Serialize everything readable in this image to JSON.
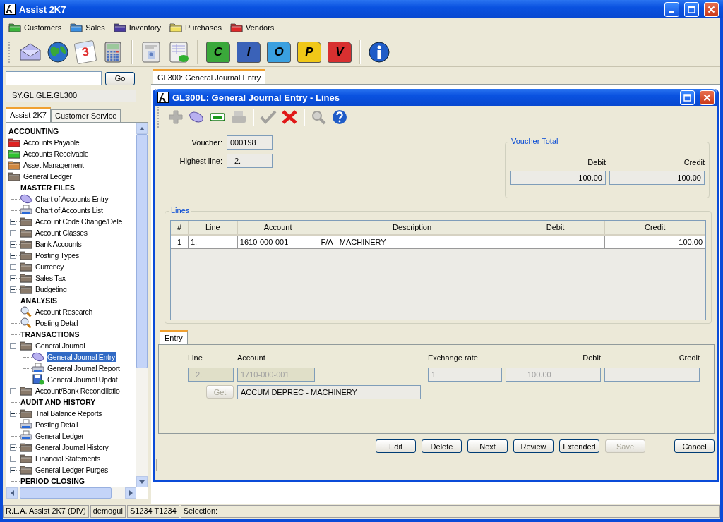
{
  "window": {
    "title": "Assist 2K7"
  },
  "menu": [
    {
      "label": "Customers",
      "color": "#3cb43c"
    },
    {
      "label": "Sales",
      "color": "#3a8ee0"
    },
    {
      "label": "Inventory",
      "color": "#4a3aa0"
    },
    {
      "label": "Purchases",
      "color": "#f0e060"
    },
    {
      "label": "Vendors",
      "color": "#e02828"
    }
  ],
  "toolbar": [
    [
      {
        "kind": "mail"
      },
      {
        "kind": "globe"
      },
      {
        "kind": "calendar",
        "text": "3"
      },
      {
        "kind": "calculator"
      }
    ],
    [
      {
        "kind": "contacts"
      },
      {
        "kind": "report"
      }
    ],
    [
      {
        "kind": "folder",
        "text": "C",
        "color": "#3aa83a"
      },
      {
        "kind": "folder",
        "text": "I",
        "color": "#3a62b8"
      },
      {
        "kind": "folder",
        "text": "O",
        "color": "#3aa0e0"
      },
      {
        "kind": "folder",
        "text": "P",
        "color": "#f0c818"
      },
      {
        "kind": "folder",
        "text": "V",
        "color": "#d83030"
      }
    ],
    [
      {
        "kind": "info"
      }
    ]
  ],
  "navigator": {
    "go_button": "Go",
    "path": "SY.GL.GLE.GL300",
    "tabs": [
      {
        "label": "Assist 2K7",
        "selected": true
      },
      {
        "label": "Customer Service",
        "selected": false
      }
    ],
    "tree": [
      {
        "label": "ACCOUNTING",
        "kind": "heading",
        "selected": false
      },
      {
        "label": "Accounts Payable",
        "kind": "folder",
        "color": "#e02020",
        "selected": false
      },
      {
        "label": "Accounts Receivable",
        "kind": "folder",
        "color": "#30c030",
        "selected": false
      },
      {
        "label": "Asset Management",
        "kind": "folder",
        "color": "#d08840",
        "selected": false
      },
      {
        "label": "General Ledger",
        "kind": "folder",
        "color": "#8a7a6a",
        "selected": false,
        "children": [
          {
            "label": "MASTER FILES",
            "kind": "heading",
            "selected": false
          },
          {
            "label": "Chart of Accounts Entry",
            "kind": "entry",
            "selected": false
          },
          {
            "label": "Chart of Accounts List",
            "kind": "report",
            "selected": false
          },
          {
            "label": "Account Code Change/Dele",
            "kind": "folder",
            "color": "#8a7a6a",
            "expanded": false,
            "selected": false
          },
          {
            "label": "Account Classes",
            "kind": "folder",
            "color": "#8a7a6a",
            "expanded": false,
            "selected": false
          },
          {
            "label": "Bank Accounts",
            "kind": "folder",
            "color": "#8a7a6a",
            "expanded": false,
            "selected": false
          },
          {
            "label": "Posting Types",
            "kind": "folder",
            "color": "#8a7a6a",
            "expanded": false,
            "selected": false
          },
          {
            "label": "Currency",
            "kind": "folder",
            "color": "#8a7a6a",
            "expanded": false,
            "selected": false
          },
          {
            "label": "Sales Tax",
            "kind": "folder",
            "color": "#8a7a6a",
            "expanded": false,
            "selected": false
          },
          {
            "label": "Budgeting",
            "kind": "folder",
            "color": "#8a7a6a",
            "expanded": false,
            "selected": false
          },
          {
            "label": "ANALYSIS",
            "kind": "heading",
            "selected": false
          },
          {
            "label": "Account Research",
            "kind": "search",
            "selected": false
          },
          {
            "label": "Posting Detail",
            "kind": "search",
            "selected": false
          },
          {
            "label": "TRANSACTIONS",
            "kind": "heading",
            "selected": false
          },
          {
            "label": "General Journal",
            "kind": "folder",
            "color": "#8a7a6a",
            "expanded": true,
            "selected": false,
            "children": [
              {
                "label": "General Journal Entry",
                "kind": "entry",
                "selected": true
              },
              {
                "label": "General Journal Report",
                "kind": "report",
                "selected": false
              },
              {
                "label": "General Journal Updat",
                "kind": "update",
                "selected": false
              }
            ]
          },
          {
            "label": "Account/Bank Reconciliatio",
            "kind": "folder",
            "color": "#8a7a6a",
            "expanded": false,
            "selected": false
          },
          {
            "label": "AUDIT AND HISTORY",
            "kind": "heading",
            "selected": false
          },
          {
            "label": "Trial Balance Reports",
            "kind": "folder",
            "color": "#8a7a6a",
            "expanded": false,
            "selected": false
          },
          {
            "label": "Posting Detail",
            "kind": "report",
            "selected": false
          },
          {
            "label": "General Ledger",
            "kind": "report",
            "selected": false
          },
          {
            "label": "General Journal History",
            "kind": "folder",
            "color": "#8a7a6a",
            "expanded": false,
            "selected": false
          },
          {
            "label": "Financial Statements",
            "kind": "folder",
            "color": "#8a7a6a",
            "expanded": false,
            "selected": false
          },
          {
            "label": "General Ledger Purges",
            "kind": "folder",
            "color": "#8a7a6a",
            "expanded": false,
            "selected": false
          },
          {
            "label": "PERIOD CLOSING",
            "kind": "heading",
            "selected": false
          }
        ]
      }
    ]
  },
  "document_tabs": [
    {
      "label": "GL300: General Journal Entry",
      "selected": true
    }
  ],
  "form": {
    "title": "GL300L: General Journal Entry - Lines",
    "tools": [
      {
        "kind": "add",
        "disabled": true
      },
      {
        "kind": "edit",
        "disabled": false
      },
      {
        "kind": "minus",
        "disabled": false
      },
      {
        "kind": "print",
        "disabled": true
      },
      {
        "kind": "accept",
        "disabled": true
      },
      {
        "kind": "cancel",
        "disabled": false
      },
      {
        "kind": "find",
        "disabled": true
      },
      {
        "kind": "help",
        "disabled": false
      }
    ],
    "voucher_label": "Voucher:",
    "voucher": "000198",
    "highest_line_label": "Highest line:",
    "highest_line": "2.",
    "voucher_total": {
      "legend": "Voucher Total",
      "debit_label": "Debit",
      "credit_label": "Credit",
      "debit": "100.00",
      "credit": "100.00"
    },
    "lines": {
      "legend": "Lines",
      "columns": [
        "#",
        "Line",
        "Account",
        "Description",
        "Debit",
        "Credit"
      ],
      "rows": [
        {
          "cells": [
            "1",
            "1.",
            "1610-000-001",
            "F/A - MACHINERY",
            null,
            "100.00"
          ],
          "selected": false
        }
      ]
    },
    "entry_tabs": [
      {
        "label": "Entry",
        "selected": true
      }
    ],
    "entry": {
      "labels": [
        "Line",
        "Account",
        "Exchange rate",
        "Debit",
        "Credit"
      ],
      "line": {
        "value": "2.",
        "disabled": true
      },
      "account": {
        "value": "1710-000-001",
        "disabled": true
      },
      "exchange_rate": {
        "value": "1",
        "disabled": true
      },
      "debit": {
        "value": "100.00",
        "disabled": true
      },
      "get_button": {
        "label": "Get",
        "disabled": true
      },
      "account_name": {
        "value": "ACCUM DEPREC - MACHINERY",
        "disabled": false
      }
    },
    "buttons": [
      {
        "label": "Edit",
        "disabled": false
      },
      {
        "label": "Delete",
        "disabled": false
      },
      {
        "label": "Next",
        "disabled": false
      },
      {
        "label": "Review",
        "disabled": false
      },
      {
        "label": "Extended",
        "disabled": false
      },
      {
        "label": "Save",
        "disabled": true
      },
      {
        "label": "Cancel",
        "disabled": false
      }
    ]
  },
  "status_bar": [
    "R.L.A. Assist 2K7 (DIV)",
    "demogui",
    "S1234 T1234",
    "Selection:"
  ]
}
